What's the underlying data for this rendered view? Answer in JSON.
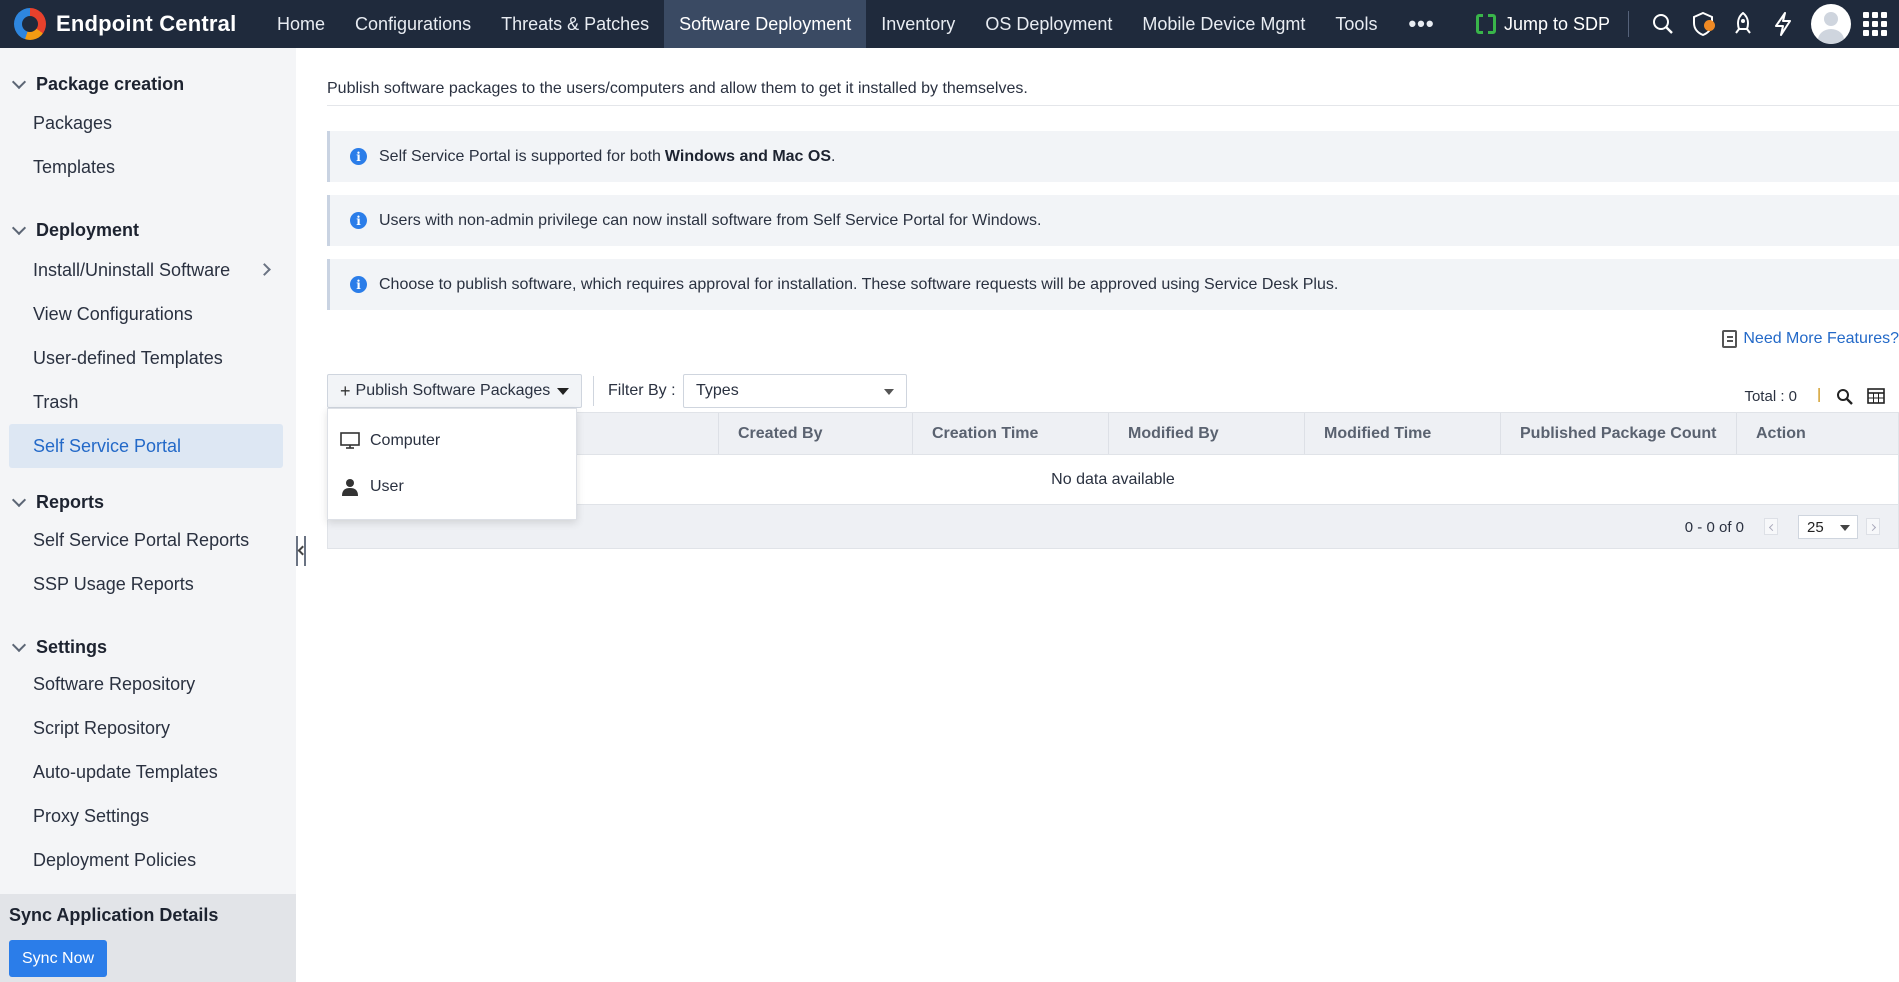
{
  "app": {
    "brand": "Endpoint Central"
  },
  "nav": {
    "items": [
      "Home",
      "Configurations",
      "Threats & Patches",
      "Software Deployment",
      "Inventory",
      "OS Deployment",
      "Mobile Device Mgmt",
      "Tools"
    ],
    "active": "Software Deployment",
    "jump_label": "Jump to SDP"
  },
  "sidebar": {
    "sections": [
      {
        "title": "Package creation",
        "items": [
          "Packages",
          "Templates"
        ]
      },
      {
        "title": "Deployment",
        "items": [
          "Install/Uninstall Software",
          "View Configurations",
          "User-defined Templates",
          "Trash",
          "Self Service Portal"
        ]
      },
      {
        "title": "Reports",
        "items": [
          "Self Service Portal Reports",
          "SSP Usage Reports"
        ]
      },
      {
        "title": "Settings",
        "items": [
          "Software Repository",
          "Script Repository",
          "Auto-update Templates",
          "Proxy Settings",
          "Deployment Policies"
        ]
      }
    ],
    "active_item": "Self Service Portal",
    "sync_title": "Sync Application Details",
    "sync_button": "Sync Now"
  },
  "main": {
    "description": "Publish software packages to the users/computers and allow them to get it installed by themselves.",
    "info": [
      {
        "text": "Self Service Portal is supported for both",
        "bold": "Windows and Mac OS",
        "after": "."
      },
      {
        "text": "Users with non-admin privilege can now install software from Self Service Portal for Windows.",
        "bold": "",
        "after": ""
      },
      {
        "text": "Choose to publish software, which requires approval for installation. These software requests will be approved using Service Desk Plus.",
        "bold": "",
        "after": ""
      }
    ],
    "need_more": "Need More Features?",
    "publish_button": "Publish Software Packages",
    "filter_label": "Filter By :",
    "filter_value": "Types",
    "total": "Total : 0",
    "columns": [
      "Created By",
      "Creation Time",
      "Modified By",
      "Modified Time",
      "Published Package Count",
      "Action"
    ],
    "empty_text": "No data available",
    "range": "0 - 0 of 0",
    "page_size": "25",
    "dropdown": [
      "Computer",
      "User"
    ]
  },
  "colors": {
    "topbar": "#1f2a3c",
    "accent": "#2b7de9",
    "link": "#2369c8",
    "active_bg": "#dde7f3"
  }
}
